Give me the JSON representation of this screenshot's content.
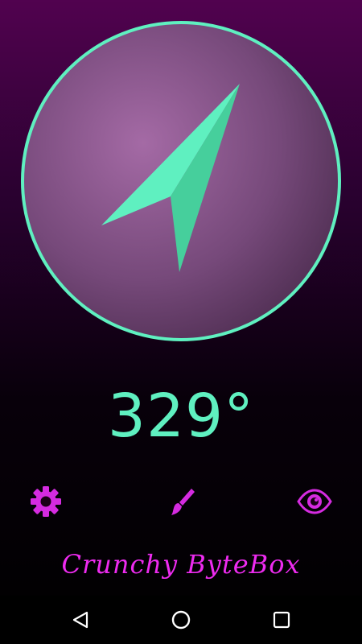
{
  "compass": {
    "heading_text": "329°",
    "heading_degrees": 329
  },
  "toolbar": {
    "settings_icon": "gear-icon",
    "theme_icon": "brush-icon",
    "visibility_icon": "eye-icon"
  },
  "branding": {
    "text": "Crunchy ByteBox"
  },
  "navbar": {
    "back_icon": "triangle-back-icon",
    "home_icon": "circle-home-icon",
    "recents_icon": "square-recents-icon"
  },
  "colors": {
    "accent_teal": "#5ff0c0",
    "accent_magenta": "#d52be0",
    "brand_pink": "#ee2bf0",
    "dial_center": "#a46aa5",
    "dial_edge": "#4d2d50"
  }
}
